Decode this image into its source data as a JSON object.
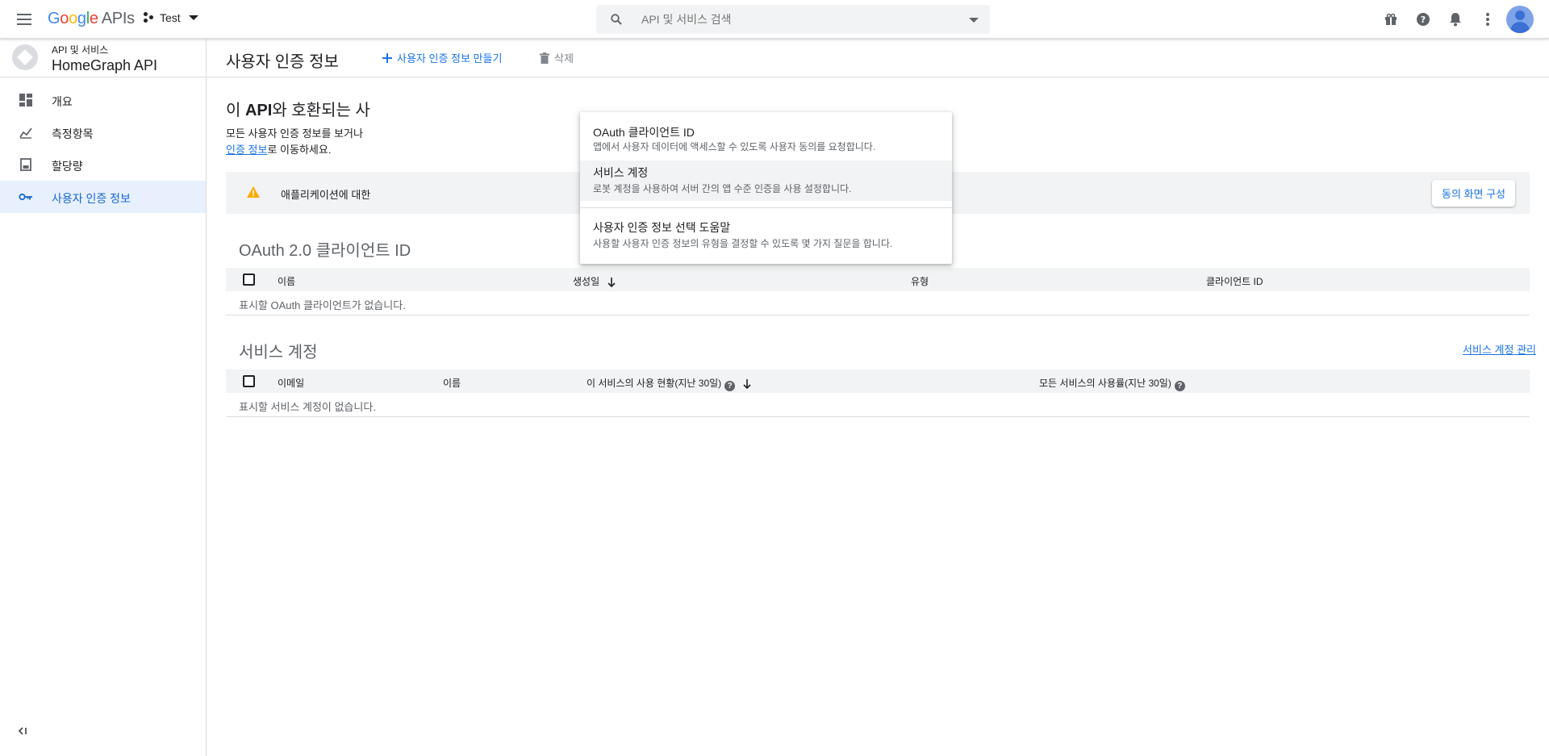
{
  "header": {
    "logo_google": "Google",
    "logo_apis": "APIs",
    "project": "Test",
    "search_placeholder": "API 및 서비스 검색"
  },
  "sidebar": {
    "api_sub": "API 및 서비스",
    "api_name": "HomeGraph API",
    "items": [
      {
        "label": "개요",
        "icon": "dashboard-icon"
      },
      {
        "label": "측정항목",
        "icon": "metrics-icon"
      },
      {
        "label": "할당량",
        "icon": "quota-icon"
      },
      {
        "label": "사용자 인증 정보",
        "icon": "key-icon"
      }
    ],
    "collapse_label": "<|"
  },
  "actionbar": {
    "title": "사용자 인증 정보",
    "create_label": "사용자 인증 정보 만들기",
    "delete_label": "삭제"
  },
  "intro": {
    "heading_prefix": "이 ",
    "heading_api": "API",
    "heading_rest": "와 호환되는 사",
    "desc_line1": "모든 사용자 인증 정보를 보거나",
    "desc_link": "인증 정보",
    "desc_line2_rest": "로 이동하세요."
  },
  "banner": {
    "text": "애플리케이션에 대한",
    "button": "동의 화면 구성"
  },
  "oauth_section": {
    "title": "OAuth 2.0 클라이언트 ID",
    "columns": [
      "이름",
      "생성일",
      "유형",
      "클라이언트 ID"
    ],
    "empty": "표시할 OAuth 클라이언트가 없습니다."
  },
  "service_section": {
    "title": "서비스 계정",
    "manage_link": "서비스 계정 관리",
    "columns": [
      "이메일",
      "이름",
      "이 서비스의 사용 현황(지난 30일)",
      "모든 서비스의 사용률(지난 30일)"
    ],
    "empty": "표시할 서비스 계정이 없습니다."
  },
  "dropdown": {
    "items": [
      {
        "title": "OAuth 클라이언트 ID",
        "desc": "앱에서 사용자 데이터에 액세스할 수 있도록 사용자 동의를 요청합니다."
      },
      {
        "title": "서비스 계정",
        "desc": "로봇 계정을 사용하여 서버 간의 앱 수준 인증을 사용 설정합니다."
      },
      {
        "title": "사용자 인증 정보 선택 도움말",
        "desc": "사용할 사용자 인증 정보의 유형을 결정할 수 있도록 몇 가지 질문을 합니다."
      }
    ]
  }
}
